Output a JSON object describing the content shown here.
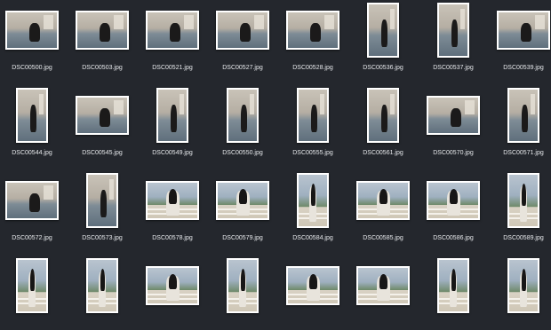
{
  "files": [
    {
      "name": "DSC00500.jpg",
      "orientation": "land",
      "scene": "room"
    },
    {
      "name": "DSC00503.jpg",
      "orientation": "land",
      "scene": "room"
    },
    {
      "name": "DSC00521.jpg",
      "orientation": "land",
      "scene": "room"
    },
    {
      "name": "DSC00527.jpg",
      "orientation": "land",
      "scene": "room"
    },
    {
      "name": "DSC00528.jpg",
      "orientation": "land",
      "scene": "room"
    },
    {
      "name": "DSC00536.jpg",
      "orientation": "port",
      "scene": "room"
    },
    {
      "name": "DSC00537.jpg",
      "orientation": "port",
      "scene": "room"
    },
    {
      "name": "DSC00539.jpg",
      "orientation": "land",
      "scene": "room"
    },
    {
      "name": "DSC00544.jpg",
      "orientation": "port",
      "scene": "room"
    },
    {
      "name": "DSC00545.jpg",
      "orientation": "land",
      "scene": "room"
    },
    {
      "name": "DSC00549.jpg",
      "orientation": "port",
      "scene": "room"
    },
    {
      "name": "DSC00550.jpg",
      "orientation": "port",
      "scene": "room"
    },
    {
      "name": "DSC00555.jpg",
      "orientation": "port",
      "scene": "room"
    },
    {
      "name": "DSC00561.jpg",
      "orientation": "port",
      "scene": "room"
    },
    {
      "name": "DSC00570.jpg",
      "orientation": "land",
      "scene": "room"
    },
    {
      "name": "DSC00571.jpg",
      "orientation": "port",
      "scene": "room"
    },
    {
      "name": "DSC00572.jpg",
      "orientation": "land",
      "scene": "room"
    },
    {
      "name": "DSC00573.jpg",
      "orientation": "port",
      "scene": "room"
    },
    {
      "name": "DSC00578.jpg",
      "orientation": "land",
      "scene": "balcony"
    },
    {
      "name": "DSC00579.jpg",
      "orientation": "land",
      "scene": "balcony"
    },
    {
      "name": "DSC00584.jpg",
      "orientation": "port",
      "scene": "balcony"
    },
    {
      "name": "DSC00585.jpg",
      "orientation": "land",
      "scene": "balcony"
    },
    {
      "name": "DSC00586.jpg",
      "orientation": "land",
      "scene": "balcony"
    },
    {
      "name": "DSC00589.jpg",
      "orientation": "port",
      "scene": "balcony"
    },
    {
      "name": "",
      "orientation": "port",
      "scene": "balcony"
    },
    {
      "name": "",
      "orientation": "port",
      "scene": "balcony"
    },
    {
      "name": "",
      "orientation": "land",
      "scene": "balcony"
    },
    {
      "name": "",
      "orientation": "port",
      "scene": "balcony"
    },
    {
      "name": "",
      "orientation": "land",
      "scene": "balcony"
    },
    {
      "name": "",
      "orientation": "land",
      "scene": "balcony"
    },
    {
      "name": "",
      "orientation": "port",
      "scene": "balcony"
    },
    {
      "name": "",
      "orientation": "port",
      "scene": "balcony"
    }
  ]
}
